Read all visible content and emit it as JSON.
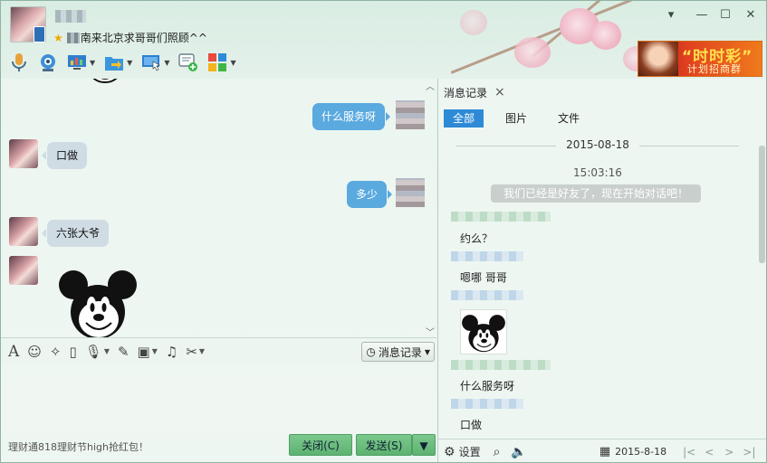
{
  "window": {
    "signature": "南来北京求哥哥们照顾^^",
    "controls": [
      "▾",
      "—",
      "☐",
      "✕"
    ]
  },
  "toolbar": {
    "items": [
      {
        "name": "voice",
        "icon": "microphone-icon",
        "caret": false
      },
      {
        "name": "video",
        "icon": "webcam-icon",
        "caret": false
      },
      {
        "name": "remote",
        "icon": "screen-share-icon",
        "caret": true
      },
      {
        "name": "file",
        "icon": "folder-send-icon",
        "caret": true
      },
      {
        "name": "screen",
        "icon": "remote-desktop-icon",
        "caret": true
      },
      {
        "name": "invite",
        "icon": "add-chat-icon",
        "caret": false
      },
      {
        "name": "apps",
        "icon": "apps-grid-icon",
        "caret": true
      }
    ]
  },
  "ad": {
    "line1": "“时时彩”",
    "line2": "计划招商群"
  },
  "chat": {
    "messages": [
      {
        "side": "right",
        "text": "什么服务呀"
      },
      {
        "side": "left",
        "text": "口做"
      },
      {
        "side": "right",
        "text": "多少"
      },
      {
        "side": "left",
        "text": "六张大爷"
      }
    ]
  },
  "input_toolbar": {
    "history_label": "消息记录"
  },
  "footer": {
    "ad_text": "理财通818理财节high抢红包！",
    "close_label": "关闭(C)",
    "send_label": "发送(S)"
  },
  "history": {
    "tab_label": "消息记录",
    "tab_close": "×",
    "filters": [
      "全部",
      "图片",
      "文件"
    ],
    "date": "2015-08-18",
    "time": "15:03:16",
    "system_message": "我们已经是好友了，现在开始对话吧！",
    "entries": [
      "约么？",
      "嗯哪 哥哥",
      "什么服务呀",
      "口做"
    ],
    "settings_label": "设置",
    "footer_date": "2015-8-18"
  }
}
